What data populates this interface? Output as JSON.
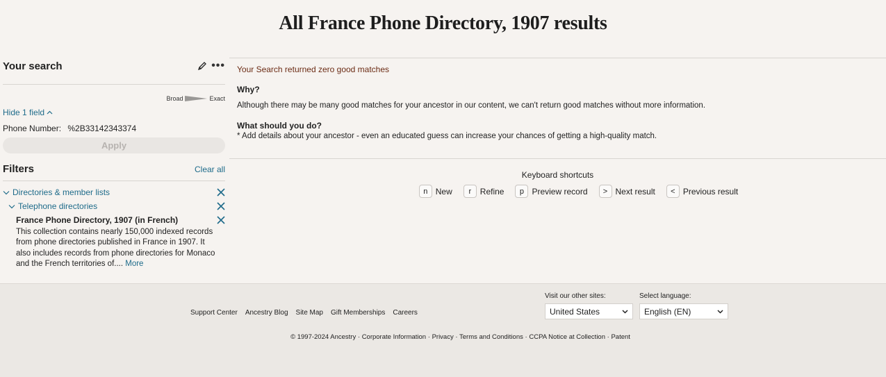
{
  "page": {
    "title": "All France Phone Directory, 1907 results"
  },
  "sidebar": {
    "your_search": {
      "title": "Your search",
      "edit_icon": "pencil-icon",
      "more_icon": "more-dots-icon",
      "slider": {
        "left_label": "Broad",
        "right_label": "Exact"
      },
      "hide_fields_label": "Hide 1 field",
      "fields": [
        {
          "label": "Phone Number:",
          "value": "%2B33142343374"
        }
      ],
      "apply_label": "Apply"
    },
    "filters": {
      "title": "Filters",
      "clear_all_label": "Clear all",
      "items": [
        {
          "label": "Directories & member lists",
          "level": 1
        },
        {
          "label": "Telephone directories",
          "level": 2
        },
        {
          "label": "France Phone Directory, 1907 (in French)",
          "level": 3
        }
      ],
      "collection_description": "This collection contains nearly 150,000 indexed records from phone directories published in France in 1907. It also includes records from phone directories for Monaco and the French territories of....",
      "more_label": "More"
    }
  },
  "main": {
    "zero_matches": "Your Search returned zero good matches",
    "why_heading": "Why?",
    "why_text": "Although there may be many good matches for your ancestor in our content, we can't return good matches without more information.",
    "what_heading": "What should you do?",
    "what_text": "* Add details about your ancestor - even an educated guess can increase your chances of getting a high-quality match.",
    "keyboard": {
      "title": "Keyboard shortcuts",
      "shortcuts": [
        {
          "key": "n",
          "label": "New"
        },
        {
          "key": "r",
          "label": "Refine"
        },
        {
          "key": "p",
          "label": "Preview record"
        },
        {
          "key": ">",
          "label": "Next result"
        },
        {
          "key": "<",
          "label": "Previous result"
        }
      ]
    }
  },
  "footer": {
    "links": [
      "Support Center",
      "Ancestry Blog",
      "Site Map",
      "Gift Memberships",
      "Careers"
    ],
    "other_sites": {
      "label": "Visit our other sites:",
      "selected": "United States"
    },
    "language": {
      "label": "Select language:",
      "selected": "English (EN)"
    },
    "copyright": "© 1997-2024 Ancestry",
    "legal_links": [
      "Corporate Information",
      "Privacy",
      "Terms and Conditions",
      "CCPA Notice at Collection",
      "Patent"
    ]
  }
}
